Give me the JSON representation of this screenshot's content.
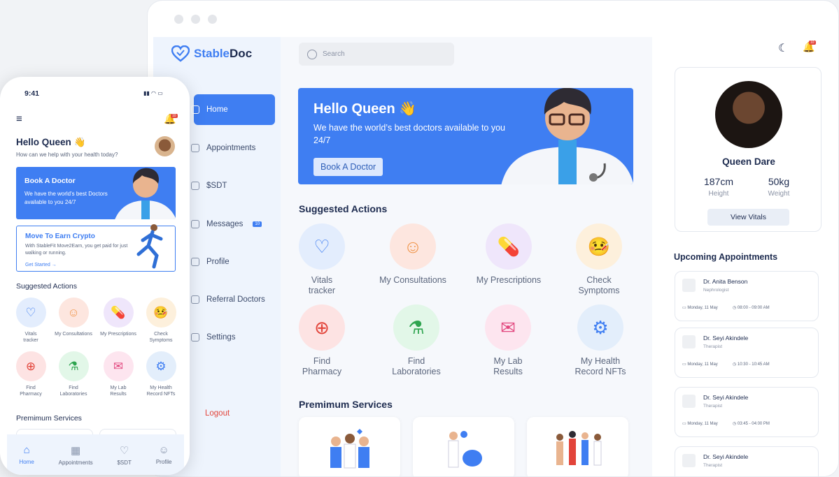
{
  "browser": {
    "logo": {
      "part1": "Stable",
      "part2": "Doc"
    },
    "nav": [
      {
        "label": "Home",
        "icon": "home-icon"
      },
      {
        "label": "Appointments",
        "icon": "calendar-icon"
      },
      {
        "label": "$SDT",
        "icon": "token-icon"
      },
      {
        "label": "Messages",
        "icon": "chat-icon",
        "badge": "10"
      },
      {
        "label": "Profile",
        "icon": "user-icon"
      },
      {
        "label": "Referral Doctors",
        "icon": "doctor-icon"
      },
      {
        "label": "Settings",
        "icon": "gear-icon"
      }
    ],
    "logout": "Logout",
    "search_placeholder": "Search",
    "hero": {
      "title": "Hello Queen 👋",
      "text": "We have the world’s best doctors available to you 24/7",
      "button": "Book A Doctor"
    },
    "suggested_title": "Suggested Actions",
    "actions": [
      {
        "label": "Vitals tracker",
        "icon": "heartbeat-icon",
        "color": "#e3edfd"
      },
      {
        "label": "My Consultations",
        "icon": "doctor-icon",
        "color": "#fde6df"
      },
      {
        "label": "My Prescriptions",
        "icon": "pills-icon",
        "color": "#efe6fb"
      },
      {
        "label": "Check Symptoms",
        "icon": "sick-face-icon",
        "color": "#fdf0dc"
      },
      {
        "label": "Find Pharmacy",
        "icon": "pharmacy-cross-icon",
        "color": "#fde3e3"
      },
      {
        "label": "Find Laboratories",
        "icon": "flask-icon",
        "color": "#e2f7e8"
      },
      {
        "label": "My Lab Results",
        "icon": "envelope-icon",
        "color": "#fde5ef"
      },
      {
        "label": "My Health Record NFTs",
        "icon": "gear-wheel-icon",
        "color": "#e3eefb"
      }
    ],
    "premium_title": "Premimum Services",
    "profile": {
      "name": "Queen Dare",
      "height_value": "187cm",
      "height_label": "Height",
      "weight_value": "50kg",
      "weight_label": "Weight",
      "button": "View Vitals"
    },
    "upcoming_title": "Upcoming Appointments",
    "appointments": [
      {
        "doctor": "Dr. Anita Benson",
        "specialty": "Nephrologist",
        "date": "Monday, 11 May",
        "time": "08:00 - 09:00 AM"
      },
      {
        "doctor": "Dr. Seyi Akindele",
        "specialty": "Therapist",
        "date": "Monday, 11 May",
        "time": "10:30 - 10:45 AM"
      },
      {
        "doctor": "Dr. Seyi Akindele",
        "specialty": "Therapist",
        "date": "Monday, 11 May",
        "time": "03:45 - 04:00 PM"
      },
      {
        "doctor": "Dr. Seyi Akindele",
        "specialty": "Therapist"
      }
    ],
    "notification_badge": "10"
  },
  "phone": {
    "time": "9:41",
    "hello": "Hello Queen 👋",
    "subtitle": "How can we help with your health today?",
    "book": {
      "title": "Book A Doctor",
      "text": "We have the world's best Doctors available to you 24/7"
    },
    "move": {
      "title": "Move To Earn Crypto",
      "text": "With StableFit Move2Earn, you get paid for just walking or running.",
      "link": "Get Started →"
    },
    "suggested_title": "Suggested Actions",
    "actions": [
      {
        "label": "Vitals tracker"
      },
      {
        "label": "My Consultations"
      },
      {
        "label": "My Prescriptions"
      },
      {
        "label": "Check Symptoms"
      },
      {
        "label": "Find Pharmacy"
      },
      {
        "label": "Find Laboratories"
      },
      {
        "label": "My Lab Results"
      },
      {
        "label": "My Health Record NFTs"
      }
    ],
    "premium_title": "Premimum Services",
    "tabs": [
      {
        "label": "Home",
        "icon": "home-icon"
      },
      {
        "label": "Appointments",
        "icon": "calendar-icon"
      },
      {
        "label": "$SDT",
        "icon": "token-icon"
      },
      {
        "label": "Profile",
        "icon": "user-icon"
      }
    ],
    "notification_badge": "10"
  }
}
